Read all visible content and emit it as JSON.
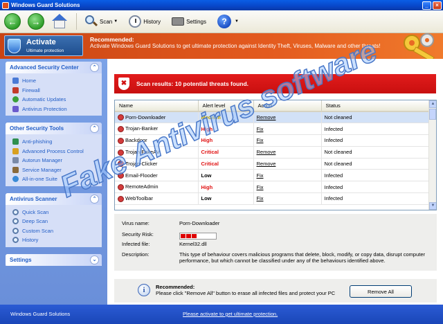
{
  "window": {
    "title": "Windows Guard Solutions"
  },
  "toolbar": {
    "back_icon": "back-arrow-icon",
    "forward_icon": "forward-arrow-icon",
    "home_icon": "home-icon",
    "scan_label": "Scan",
    "history_label": "History",
    "settings_label": "Settings",
    "help_icon": "help-icon"
  },
  "banner": {
    "activate_title": "Activate",
    "activate_sub": "Ultimate protection",
    "rec_title": "Recommended:",
    "rec_text": "Activate Windows Guard Solutions to get ultimate protection against Identity Theft, Viruses, Malware and other threats!"
  },
  "sidebar": {
    "panels": [
      {
        "title": "Advanced Security Center",
        "items": [
          "Home",
          "Firewall",
          "Automatic Updates",
          "Antivirus Protection"
        ]
      },
      {
        "title": "Other Security Tools",
        "items": [
          "Anti-phishing",
          "Advanced Process Control",
          "Autorun Manager",
          "Service Manager",
          "All-in-one Suite"
        ]
      },
      {
        "title": "Antivirus Scanner",
        "items": [
          "Quick Scan",
          "Deep Scan",
          "Custom Scan",
          "History"
        ]
      },
      {
        "title": "Settings",
        "items": []
      }
    ]
  },
  "scan": {
    "result_text": "Scan results: 10 potential threats found."
  },
  "table": {
    "columns": [
      "Name",
      "Alert level",
      "Action",
      "Status"
    ],
    "rows": [
      {
        "name": "Porn-Downloader",
        "level": "Medium",
        "action": "Remove",
        "status": "Not cleaned"
      },
      {
        "name": "Trojan-Banker",
        "level": "High",
        "action": "Fix",
        "status": "Infected"
      },
      {
        "name": "Backdoor",
        "level": "High",
        "action": "Fix",
        "status": "Infected"
      },
      {
        "name": "Trojan-FakeAV",
        "level": "Critical",
        "action": "Remove",
        "status": "Not cleaned"
      },
      {
        "name": "Trojan-Clicker",
        "level": "Critical",
        "action": "Remove",
        "status": "Not cleaned"
      },
      {
        "name": "Email-Flooder",
        "level": "Low",
        "action": "Fix",
        "status": "Infected"
      },
      {
        "name": "RemoteAdmin",
        "level": "High",
        "action": "Fix",
        "status": "Infected"
      },
      {
        "name": "WebToolbar",
        "level": "Low",
        "action": "Fix",
        "status": "Infected"
      }
    ]
  },
  "details": {
    "virus_name_label": "Virus name:",
    "virus_name": "Porn-Downloader",
    "risk_label": "Security Risk:",
    "risk_level": 0.33,
    "infected_label": "Infected file:",
    "infected_file": "Kernel32.dll",
    "desc_label": "Description:",
    "description": "This type of behaviour covers malicious programs that delete, block, modify, or copy data, disrupt computer performance, but which cannot be classified under any of the behaviours identified above."
  },
  "recommend": {
    "title": "Recommended:",
    "text": "Please click \"Remove All\" button to erase all infected files and protect your PC",
    "button": "Remove All"
  },
  "watermark": "Fake Antivirus software",
  "status": {
    "left": "Windows Guard Solutions",
    "link": "Please activate to get ultimate protection."
  }
}
